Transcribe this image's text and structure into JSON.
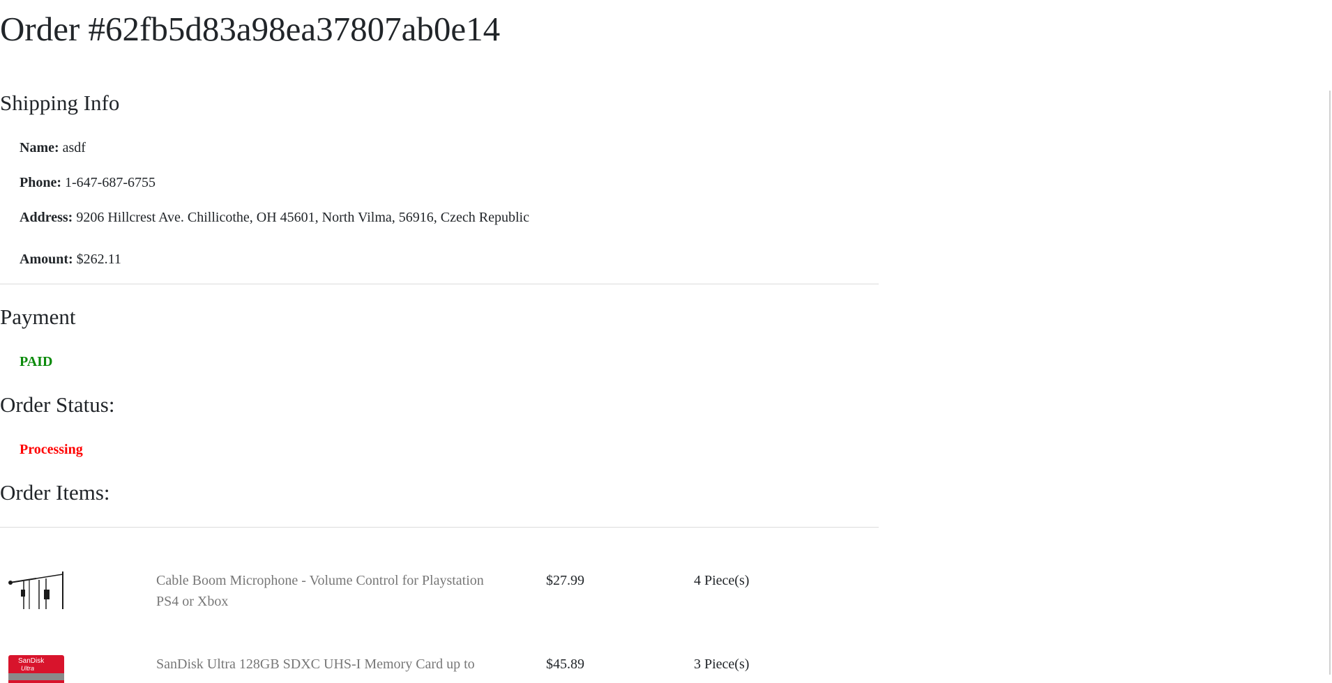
{
  "order": {
    "title": "Order #62fb5d83a98ea37807ab0e14"
  },
  "shipping": {
    "heading": "Shipping Info",
    "name_label": "Name:",
    "name_value": "asdf",
    "phone_label": "Phone:",
    "phone_value": "1-647-687-6755",
    "address_label": "Address:",
    "address_value": "9206 Hillcrest Ave. Chillicothe, OH 45601, North Vilma, 56916, Czech Republic",
    "amount_label": "Amount:",
    "amount_value": "$262.11"
  },
  "payment": {
    "heading": "Payment",
    "status": "PAID",
    "status_color": "#0a8a0a"
  },
  "order_status": {
    "heading": "Order Status:",
    "value": "Processing",
    "color": "#ff0000"
  },
  "items": {
    "heading": "Order Items:",
    "rows": [
      {
        "image": "boom-microphone-icon",
        "name": "Cable Boom Microphone - Volume Control for Playstation PS4 or Xbox",
        "price": "$27.99",
        "quantity": "4 Piece(s)"
      },
      {
        "image": "sandisk-card-icon",
        "image_brand": "SanDisk",
        "image_sub": "Ultra",
        "name": "SanDisk Ultra 128GB SDXC UHS-I Memory Card up to",
        "price": "$45.89",
        "quantity": "3 Piece(s)"
      }
    ]
  }
}
